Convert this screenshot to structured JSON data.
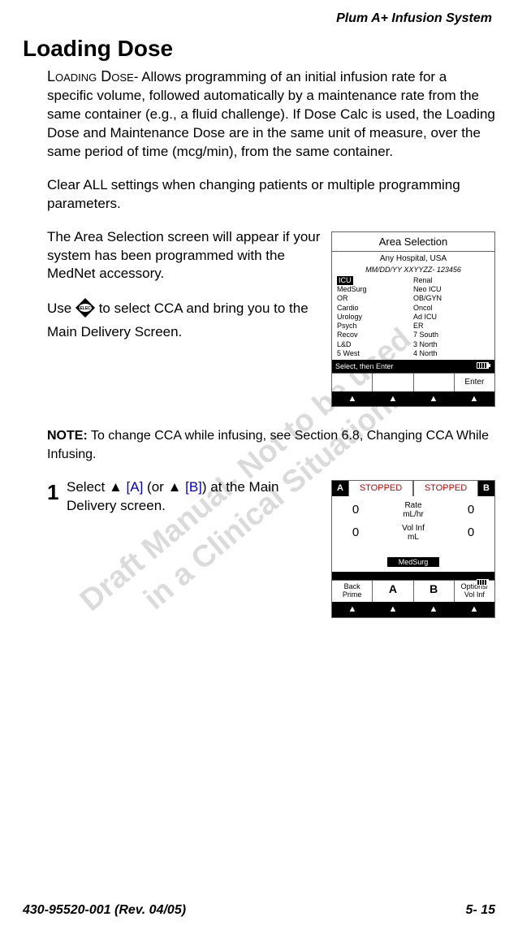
{
  "header": {
    "running_title": "Plum A+ Infusion System"
  },
  "heading": "Loading Dose",
  "paras": {
    "p1_lead": "Loading Dose",
    "p1_rest": "- Allows programming of an initial infusion rate for a specific volume, followed automatically by a maintenance rate from the same container (e.g., a fluid challenge). If Dose Calc is used, the Loading Dose and Maintenance Dose are in the same unit of measure, over the same period of time (mcg/min), from the same container.",
    "p2": "Clear ALL settings when changing patients or multiple programming parameters.",
    "p3": "The Area Selection screen will appear if your system has been programmed with the MedNet accessory.",
    "p4_a": "Use ",
    "p4_b": " to select CCA and bring you to the Main Delivery Screen."
  },
  "note": {
    "label": "NOTE:",
    "text_a": " To change CCA while infusing, ",
    "text_i": "see Section 6.8, Changing CCA While Infusing."
  },
  "step1": {
    "num": "1",
    "t1": "Select ",
    "t2_a": " [A]",
    "t_mid": " (or ",
    "t2_b": " [B]",
    "t3": ") at the Main Delivery screen."
  },
  "screen1": {
    "title": "Area Selection",
    "sub1": "Any Hospital, USA",
    "sub2": "MM/DD/YY XXYYZZ- 123456",
    "col1": [
      "ICU",
      "MedSurg",
      "OR",
      "Cardio",
      "Urology",
      "Psych",
      "Recov",
      "L&D",
      "5 West"
    ],
    "col2": [
      "Renal",
      "Neo ICU",
      "OB/GYN",
      "Oncol",
      "Ad ICU",
      "ER",
      "7 South",
      "3 North",
      "4 North"
    ],
    "bar": "Select, then Enter",
    "soft4": "Enter"
  },
  "screen2": {
    "a": "A",
    "b": "B",
    "stopped": "STOPPED",
    "rate_label1": "Rate",
    "rate_label1b": "mL/hr",
    "rate_label2": "Vol Inf",
    "rate_label2b": "mL",
    "zero": "0",
    "meds": "MedSurg",
    "sk1a": "Back",
    "sk1b": "Prime",
    "sk2": "A",
    "sk3": "B",
    "sk4a": "Options/",
    "sk4b": "Vol Inf"
  },
  "footer": {
    "left": "430-95520-001 (Rev. 04/05)",
    "right": "5- 15"
  },
  "watermark": {
    "l1": "Draft Manual- Not to be used",
    "l2": "in a Clinical Situation."
  }
}
